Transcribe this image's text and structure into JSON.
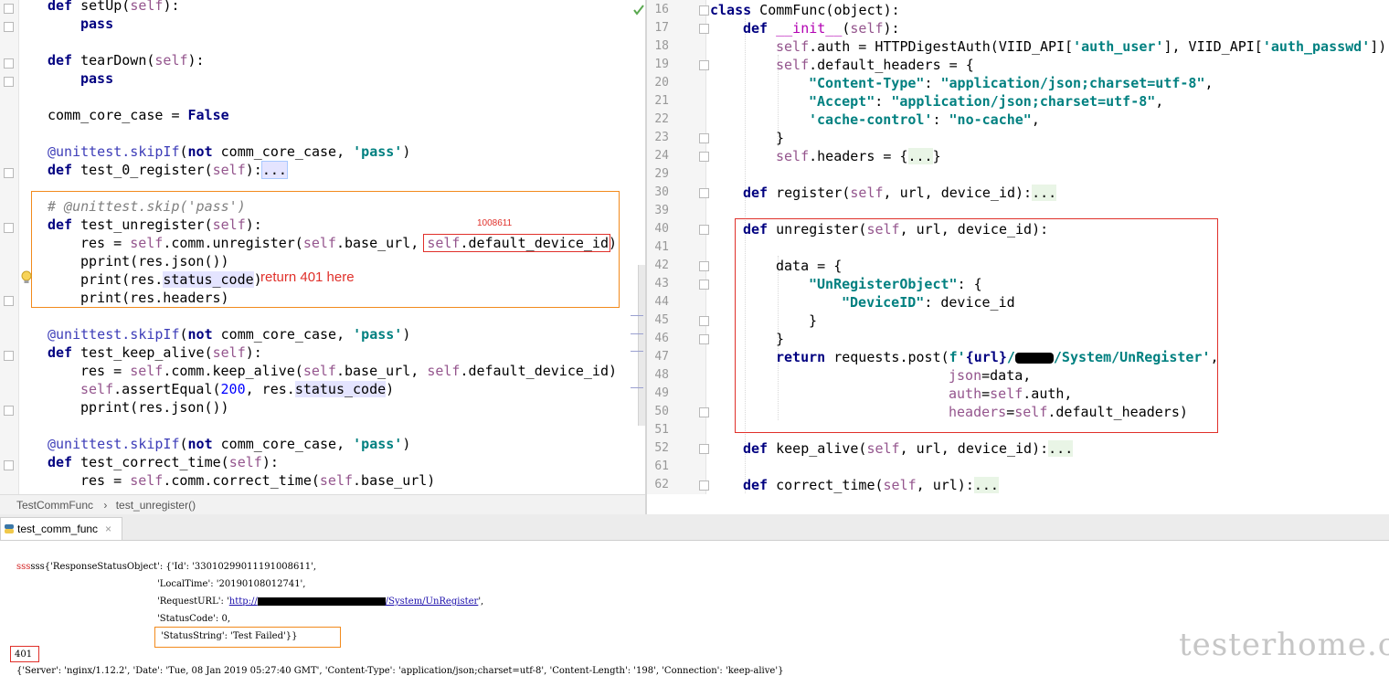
{
  "left_editor": {
    "lines": {
      "setup_def": "def setUp(self):",
      "pass1": "pass",
      "teardown_def": "def tearDown(self):",
      "pass2": "pass",
      "comm_core": "comm_core_case = False",
      "skip1": "@unittest.skipIf(not comm_core_case, 'pass')",
      "register_def": "def test_0_register(self):...",
      "comment_skip": "# @unittest.skip('pass')",
      "unregister_def": "def test_unregister(self):",
      "res_unregister": "res = self.comm.unregister(self.base_url, self.default_device_id)",
      "pprint_json": "pprint(res.json())",
      "print_status": "print(res.status_code)",
      "print_headers": "print(res.headers)",
      "skip2": "@unittest.skipIf(not comm_core_case, 'pass')",
      "keep_alive_def": "def test_keep_alive(self):",
      "res_keep_alive": "res = self.comm.keep_alive(self.base_url, self.default_device_id)",
      "assert_equal": "self.assertEqual(200, res.status_code)",
      "pprint_json2": "pprint(res.json())",
      "skip3": "@unittest.skipIf(not comm_core_case, 'pass')",
      "correct_time_def": "def test_correct_time(self):",
      "res_correct_time": "res = self.comm.correct_time(self.base_url)"
    },
    "annotation_device_id": "1008611",
    "annotation_return": "return 401 here"
  },
  "right_editor": {
    "line_numbers": [
      "16",
      "17",
      "18",
      "19",
      "20",
      "21",
      "22",
      "23",
      "24",
      "29",
      "30",
      "39",
      "40",
      "41",
      "42",
      "43",
      "44",
      "45",
      "46",
      "47",
      "48",
      "49",
      "50",
      "51",
      "52",
      "61",
      "62"
    ],
    "lines": {
      "class_def": "class CommFunc(object):",
      "init_def": "def __init__(self):",
      "auth": "self.auth = HTTPDigestAuth(VIID_API['auth_user'], VIID_API['auth_passwd'])",
      "default_headers": "self.default_headers = {",
      "content_type": "\"Content-Type\": \"application/json;charset=utf-8\",",
      "accept": "\"Accept\": \"application/json;charset=utf-8\",",
      "cache_control": "'cache-control': \"no-cache\",",
      "close_brace": "}",
      "headers": "self.headers = {...}",
      "register": "def register(self, url, device_id):...",
      "unregister": "def unregister(self, url, device_id):",
      "data_open": "data = {",
      "unregister_object": "\"UnRegisterObject\": {",
      "device_id": "\"DeviceID\": device_id",
      "inner_close": "}",
      "outer_close": "}",
      "return_prefix": "return requests.post(f'{url}/",
      "return_suffix": "/System/UnRegister',",
      "json_arg": "json=data,",
      "auth_arg": "auth=self.auth,",
      "headers_arg": "headers=self.default_headers)",
      "keep_alive": "def keep_alive(self, url, device_id):...",
      "correct_time": "def correct_time(self, url):..."
    }
  },
  "breadcrumb": {
    "class_name": "TestCommFunc",
    "separator": "›",
    "method_name": "test_unregister()"
  },
  "run_tab": {
    "label": "test_comm_func",
    "close": "×"
  },
  "console": {
    "line1_prefix": "sss{'ResponseStatusObject': {'Id': '33010299011191008611',",
    "line2": "'LocalTime': '20190108012741',",
    "line3_prefix": "'RequestURL': '",
    "line3_link_prefix": "http://",
    "line3_link_suffix": "/System/UnRegister",
    "line3_suffix": "',",
    "line4": "'StatusCode': 0,",
    "line5": "'StatusString': 'Test Failed'}}",
    "line6": "401",
    "line7": "{'Server': 'nginx/1.12.2', 'Date': 'Tue, 08 Jan 2019 05:27:40 GMT', 'Content-Type': 'application/json;charset=utf-8', 'Content-Length': '198', 'Connection': 'keep-alive'}"
  },
  "watermark": "testerhome.com",
  "colors": {
    "keyword": "#000080",
    "self": "#94558d",
    "string": "#008080",
    "annotation_box": "#f28a1c",
    "annotation_red": "#e0302a"
  }
}
